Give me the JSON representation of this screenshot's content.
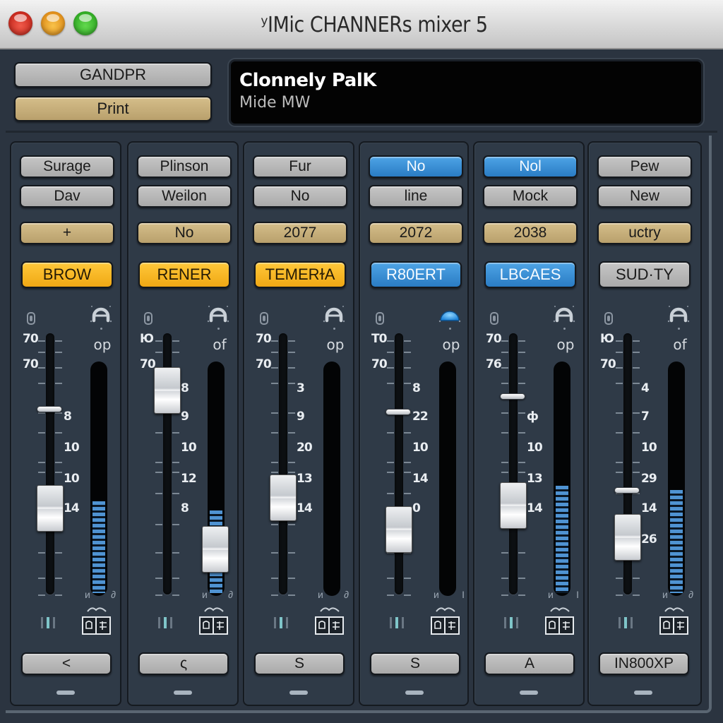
{
  "window": {
    "title": "ʸIMic CHANNERs mixer 5",
    "controls": [
      "close",
      "minimize",
      "zoom"
    ]
  },
  "header": {
    "button_top": "GANDPR",
    "button_print": "Print",
    "display": {
      "line1": "Clonnely PalK",
      "line2": "Mide MW"
    }
  },
  "colors": {
    "amber": "#f7b521",
    "blue": "#3a8fd8",
    "tan": "#c8af7a",
    "gray": "#b8b8b8",
    "meter": "#4f93d2",
    "panel": "#2f3a47"
  },
  "channels": [
    {
      "top1": {
        "label": "Surage",
        "style": "gray"
      },
      "top2": {
        "label": "Dav",
        "style": "gray"
      },
      "number": "+",
      "name": {
        "label": "BROW",
        "style": "amber"
      },
      "pan_icon": "pan-knob-icon",
      "pan_label": "op",
      "scale_left": [
        "70",
        "70"
      ],
      "scale_right": [
        "8",
        "10",
        "10",
        "14"
      ],
      "fader_level": 0.33,
      "trim_level": 0.71,
      "meter_level": 0.4,
      "meter_fader": null,
      "meter_foot": [
        "и",
        "∂"
      ],
      "bottom": "<"
    },
    {
      "top1": {
        "label": "Plinson",
        "style": "gray"
      },
      "top2": {
        "label": "Weilon",
        "style": "gray"
      },
      "number": "No",
      "name": {
        "label": "RENER",
        "style": "amber"
      },
      "pan_icon": "pan-knob-icon",
      "pan_label": "of",
      "scale_left": [
        "Ю",
        "70"
      ],
      "scale_right": [
        "8",
        "9",
        "10",
        "12",
        "8"
      ],
      "fader_level": 0.78,
      "trim_level": null,
      "meter_level": 0.36,
      "meter_fader": 0.1,
      "meter_foot": [
        "и",
        "∂"
      ],
      "bottom": "ς"
    },
    {
      "top1": {
        "label": "Fur",
        "style": "gray"
      },
      "top2": {
        "label": "No",
        "style": "gray"
      },
      "number": "2077",
      "name": {
        "label": "TEMERɫA",
        "style": "amber"
      },
      "pan_icon": "pan-knob-icon",
      "pan_label": "op",
      "scale_left": [
        "70",
        "70"
      ],
      "scale_right": [
        "3",
        "9",
        "20",
        "13",
        "14"
      ],
      "fader_level": 0.37,
      "trim_level": null,
      "meter_level": 0.0,
      "meter_fader": null,
      "meter_foot": [
        "и",
        "∂"
      ],
      "bottom": "S"
    },
    {
      "top1": {
        "label": "No",
        "style": "blue"
      },
      "top2": {
        "label": "line",
        "style": "gray"
      },
      "number": "2072",
      "name": {
        "label": "R80ERT",
        "style": "blue"
      },
      "pan_icon": "pan-knob-active-icon",
      "pan_label": "op",
      "scale_left": [
        "T0",
        "70"
      ],
      "scale_right": [
        "8",
        "22",
        "10",
        "14",
        "0"
      ],
      "fader_level": 0.25,
      "trim_level": 0.7,
      "meter_level": 0.0,
      "meter_fader": null,
      "meter_foot": [
        "и",
        "I"
      ],
      "bottom": "S"
    },
    {
      "top1": {
        "label": "Nol",
        "style": "blue"
      },
      "top2": {
        "label": "Mock",
        "style": "gray"
      },
      "number": "2038",
      "name": {
        "label": "LBCAES",
        "style": "blue"
      },
      "pan_icon": "pan-knob-icon",
      "pan_label": "op",
      "scale_left": [
        "70",
        "76"
      ],
      "scale_right": [
        "ф",
        "10",
        "13",
        "14"
      ],
      "fader_level": 0.34,
      "trim_level": 0.76,
      "meter_level": 0.47,
      "meter_fader": null,
      "meter_foot": [
        "и",
        "I"
      ],
      "bottom": "A"
    },
    {
      "top1": {
        "label": "Pew",
        "style": "gray"
      },
      "top2": {
        "label": "New",
        "style": "gray"
      },
      "number": "uctry",
      "name": {
        "label": "SUD·TY",
        "style": "gray"
      },
      "pan_icon": "pan-knob-icon",
      "pan_label": "of",
      "scale_left": [
        "Ю",
        "70"
      ],
      "scale_right": [
        "4",
        "7",
        "10",
        "29",
        "14",
        "26"
      ],
      "fader_level": 0.22,
      "trim_level": 0.4,
      "meter_level": 0.45,
      "meter_fader": null,
      "meter_foot": [
        "и",
        "∂"
      ],
      "bottom": "IN800XP"
    }
  ]
}
